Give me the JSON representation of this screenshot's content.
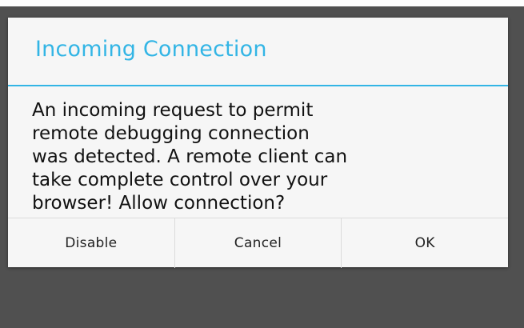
{
  "dialog": {
    "title": "Incoming Connection",
    "message": "An incoming request to permit\nremote debugging connection\nwas detected. A remote client can\ntake complete control over your\nbrowser! Allow connection?",
    "buttons": {
      "disable": "Disable",
      "cancel": "Cancel",
      "ok": "OK"
    }
  },
  "colors": {
    "accent": "#33b5e5",
    "scrim": "#505050",
    "dialog_background": "#f6f6f6"
  }
}
